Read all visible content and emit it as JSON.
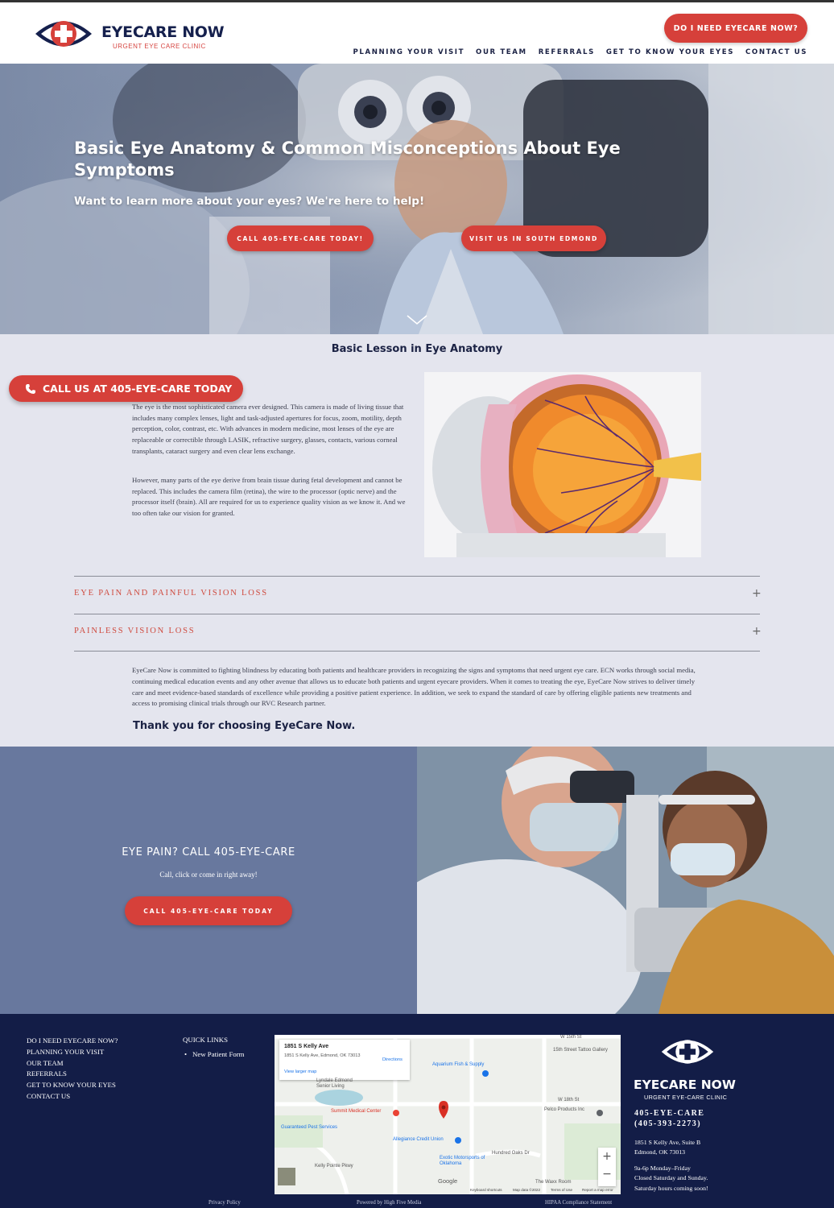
{
  "header": {
    "logo_name": "EYECARE NOW",
    "logo_sub": "URGENT EYE CARE CLINIC",
    "cta": "DO I NEED EYECARE NOW?",
    "nav": [
      "PLANNING YOUR VISIT",
      "OUR TEAM",
      "REFERRALS",
      "GET TO KNOW YOUR EYES",
      "CONTACT US"
    ]
  },
  "hero": {
    "title": "Basic Eye Anatomy & Common Misconceptions About Eye Symptoms",
    "subtitle": "Want to learn more about your eyes? We're here to help!",
    "button_call": "CALL 405-EYE-CARE TODAY!",
    "button_visit": "VISIT US IN SOUTH EDMOND"
  },
  "lesson": {
    "title": "Basic Lesson in Eye Anatomy",
    "call_pill": "CALL US AT 405-EYE-CARE TODAY",
    "paragraph1": "The eye is the most sophisticated camera ever designed. This camera is made of living tissue that includes many complex lenses, light and task-adjusted apertures for focus, zoom, motility, depth perception, color, contrast, etc. With advances in modern medicine, most lenses of the eye are replaceable or correctible through LASIK, refractive surgery, glasses, contacts, various corneal transplants, cataract surgery and even clear lens exchange.",
    "paragraph2": "However, many parts of the eye derive from brain tissue during fetal development and cannot be replaced. This includes the camera film (retina), the wire to the processor (optic nerve) and the processor itself (brain). All are required for us to experience quality vision as we know it. And we too often take our vision for granted."
  },
  "accordion": [
    {
      "label": "EYE PAIN AND PAINFUL VISION LOSS",
      "icon": "+"
    },
    {
      "label": "PAINLESS VISION LOSS",
      "icon": "+"
    }
  ],
  "mission": "EyeCare Now is committed to fighting blindness by educating both patients and healthcare providers in recognizing the signs and symptoms that need urgent eye care. ECN works through social media, continuing medical education events and any other avenue that allows us to educate both patients and urgent eyecare providers. When it comes to treating the eye, EyeCare Now strives to deliver timely care and meet evidence-based standards of excellence while providing a positive patient experience. In addition, we seek to expand the standard of care by offering eligible patients new treatments and access to promising clinical trials through our RVC Research partner.",
  "thanks": "Thank you for choosing EyeCare Now.",
  "band": {
    "title": "EYE PAIN? CALL 405-EYE-CARE",
    "subtitle": "Call, click or come in right away!",
    "button": "CALL 405-EYE-CARE TODAY"
  },
  "footer": {
    "links": [
      "DO I NEED EYECARE NOW?",
      "PLANNING YOUR VISIT",
      "OUR TEAM",
      "REFERRALS",
      "GET TO KNOW YOUR EYES",
      "CONTACT US"
    ],
    "quick_links_title": "QUICK LINKS",
    "quick_links": [
      "New Patient Form"
    ],
    "map": {
      "place": "1851 S Kelly Ave",
      "address": "1851 S Kelly Ave, Edmond, OK 73013",
      "directions": "Directions",
      "larger": "View larger map",
      "labels": [
        "Aquarium Fish & Supply",
        "15th Street Tattoo Gallery",
        "Lyndale Edmond Senior Living",
        "Summit Medical Center",
        "Pelco Products Inc",
        "Guaranteed Pest Services",
        "Allegiance Credit Union",
        "Exotic Motorsports of Oklahoma",
        "The Waxx Room",
        "W 15th St",
        "W 18th St",
        "Hundred Oaks Dr",
        "Kelly Pointe Pkwy",
        "Google",
        "Keyboard shortcuts",
        "Map data ©2022",
        "Terms of Use",
        "Report a map error"
      ]
    },
    "logo_name": "EYECARE NOW",
    "logo_sub": "URGENT EYE-CARE CLINIC",
    "phone1": "405-EYE-CARE",
    "phone2": "(405-393-2273)",
    "address1": "1851 S Kelly Ave, Suite B",
    "address2": "Edmond, OK 73013",
    "hours1": "9a-6p Monday–Friday",
    "hours2": "Closed Saturday and Sunday.",
    "hours3": "Saturday hours coming soon!",
    "privacy": "Privacy Policy",
    "powered": "Powered by High Five Media",
    "hipaa": "HIPAA Compliance Statement"
  },
  "colors": {
    "brand_red": "#d6403a",
    "navy": "#131d47",
    "band_blue": "#68789e"
  }
}
